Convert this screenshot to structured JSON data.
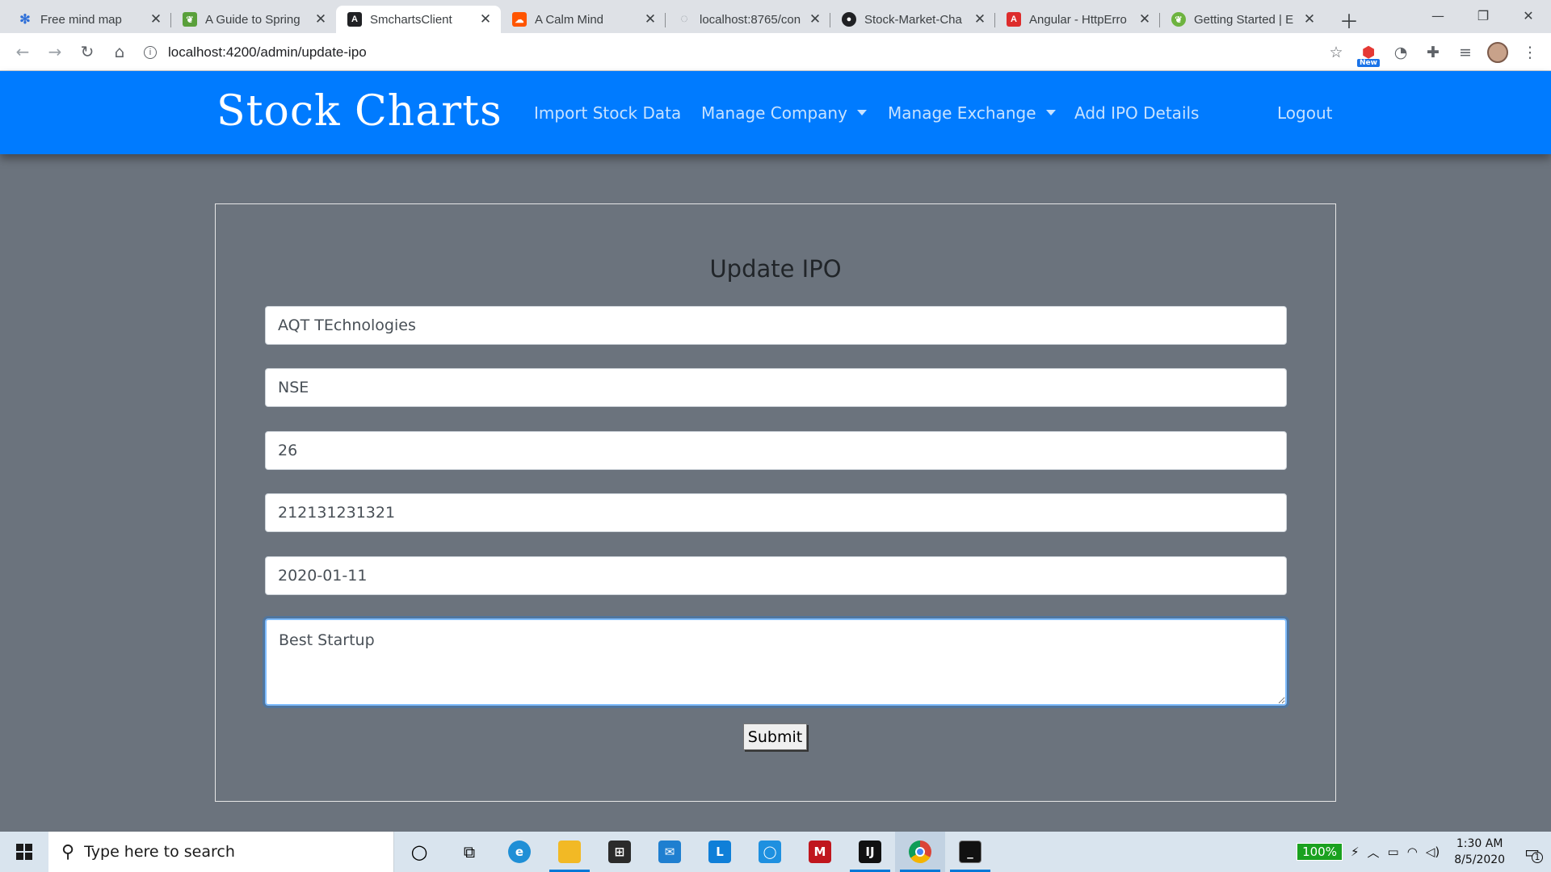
{
  "browser": {
    "tabs": [
      {
        "title": "Free mind map",
        "icon": "mindmap-icon",
        "color": "#2e6fd8"
      },
      {
        "title": "A Guide to Spring",
        "icon": "leaf-icon",
        "color": "#5aa03b"
      },
      {
        "title": "SmchartsClient",
        "icon": "angular-icon",
        "color": "#202124",
        "active": true
      },
      {
        "title": "A Calm Mind",
        "icon": "soundcloud-icon",
        "color": "#ff5500"
      },
      {
        "title": "localhost:8765/con",
        "icon": "globe-icon",
        "color": "#9aa0a6"
      },
      {
        "title": "Stock-Market-Cha",
        "icon": "github-icon",
        "color": "#202124"
      },
      {
        "title": "Angular - HttpErro",
        "icon": "angular-icon",
        "color": "#dd2c2c"
      },
      {
        "title": "Getting Started | E",
        "icon": "spring-icon",
        "color": "#6db33f"
      }
    ],
    "url": "localhost:4200/admin/update-ipo",
    "extension_badge": "New"
  },
  "navbar": {
    "brand": "Stock Charts",
    "links": {
      "import": "Import Stock Data",
      "company": "Manage Company",
      "exchange": "Manage Exchange",
      "ipo": "Add IPO Details",
      "logout": "Logout"
    }
  },
  "form": {
    "title": "Update IPO",
    "company_name": "AQT TEchnologies",
    "exchange": "NSE",
    "price_per_share": "26",
    "total_shares": "212131231321",
    "open_date": "2020-01-11",
    "remarks": "Best Startup",
    "submit_label": "Submit"
  },
  "taskbar": {
    "search_placeholder": "Type here to search",
    "battery": "100%",
    "time": "1:30 AM",
    "date": "8/5/2020",
    "notification_count": "1"
  }
}
